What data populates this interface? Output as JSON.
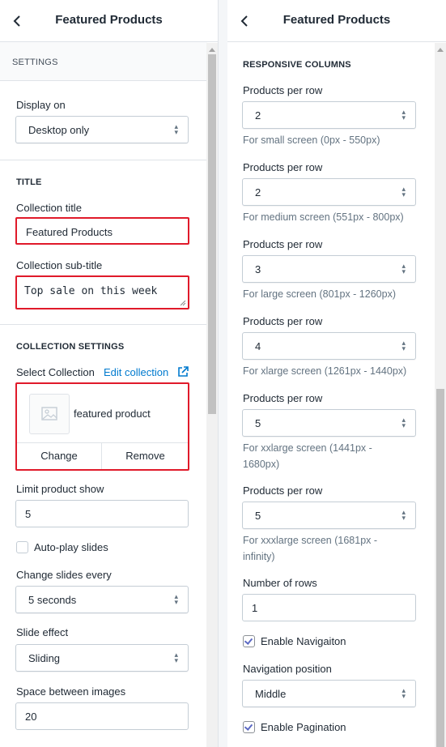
{
  "left": {
    "header_title": "Featured Products",
    "settings_heading": "SETTINGS",
    "display_on": {
      "label": "Display on",
      "value": "Desktop only"
    },
    "title_heading": "TITLE",
    "collection_title": {
      "label": "Collection title",
      "value": "Featured Products"
    },
    "collection_subtitle": {
      "label": "Collection sub-title",
      "value": "Top sale on this week"
    },
    "collection_settings_heading": "COLLECTION SETTINGS",
    "select_collection_label": "Select Collection",
    "edit_collection_link": "Edit collection",
    "selected_collection_name": "featured product",
    "change_button": "Change",
    "remove_button": "Remove",
    "limit_product": {
      "label": "Limit product show",
      "value": "5"
    },
    "autoplay_label": "Auto-play slides",
    "change_slides": {
      "label": "Change slides every",
      "value": "5 seconds"
    },
    "slide_effect": {
      "label": "Slide effect",
      "value": "Sliding"
    },
    "space_between": {
      "label": "Space between images",
      "value": "20"
    }
  },
  "right": {
    "header_title": "Featured Products",
    "responsive_heading": "RESPONSIVE COLUMNS",
    "per_row_label": "Products per row",
    "columns": [
      {
        "value": "2",
        "help": "For small screen (0px - 550px)"
      },
      {
        "value": "2",
        "help": "For medium screen (551px - 800px)"
      },
      {
        "value": "3",
        "help": "For large screen (801px - 1260px)"
      },
      {
        "value": "4",
        "help": "For xlarge screen (1261px - 1440px)"
      },
      {
        "value": "5",
        "help_line1": "For xxlarge screen (1441px -",
        "help_line2": "1680px)"
      },
      {
        "value": "5",
        "help_line1": "For xxxlarge screen (1681px -",
        "help_line2": "infinity)"
      }
    ],
    "rows": {
      "label": "Number of rows",
      "value": "1"
    },
    "enable_navigation_label": "Enable Navigaiton",
    "navigation_position": {
      "label": "Navigation position",
      "value": "Middle"
    },
    "enable_pagination_label": "Enable Pagination"
  },
  "colors": {
    "highlight": "#e01a2a",
    "link": "#007ace",
    "check": "#5c6ac4"
  },
  "icons": [
    "back-chevron-icon",
    "select-caret-icon",
    "external-link-icon",
    "image-placeholder-icon",
    "checkmark-icon"
  ]
}
